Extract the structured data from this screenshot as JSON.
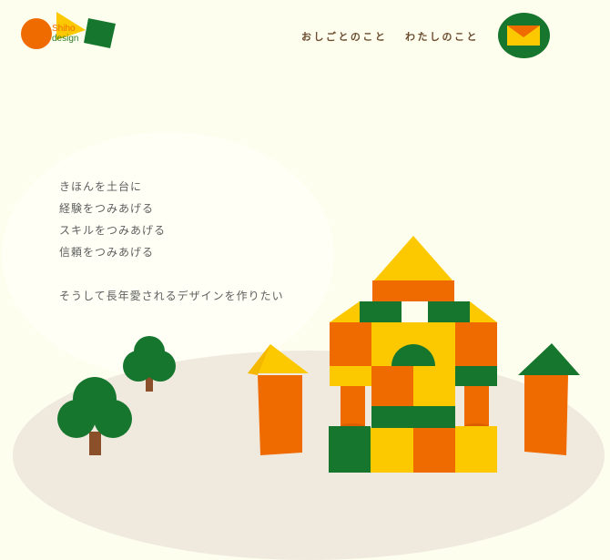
{
  "header": {
    "logo": {
      "line1": "Shiho",
      "line2": "design"
    },
    "nav": [
      {
        "label": "おしごとのこと"
      },
      {
        "label": "わたしのこと"
      }
    ],
    "mail_icon": "envelope-icon"
  },
  "hero": {
    "lines": [
      "きほんを土台に",
      "経験をつみあげる",
      "スキルをつみあげる",
      "信頼をつみあげる"
    ],
    "closing": "そうして長年愛されるデザインを作りたい"
  },
  "colors": {
    "background": "#fefeee",
    "orange": "#ef6b00",
    "yellow": "#fcc800",
    "green": "#17762e",
    "brown": "#8b4f2a",
    "ground": "#efeadd"
  }
}
